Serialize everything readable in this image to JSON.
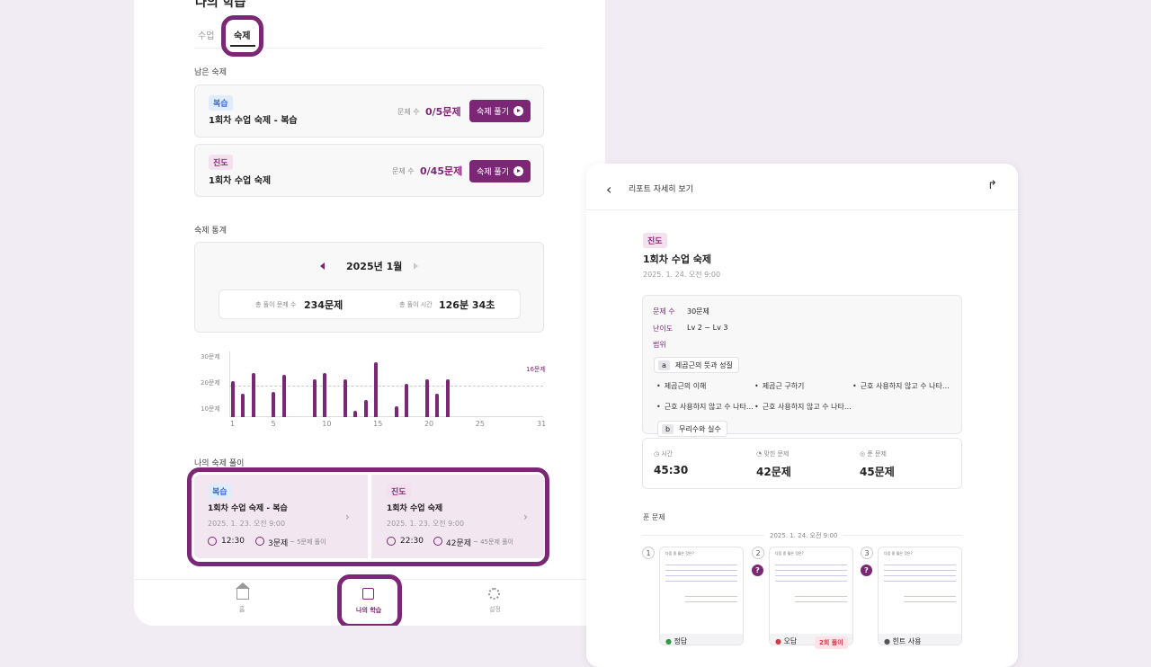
{
  "tabs": {
    "title": "나의 학습",
    "lesson": "수업",
    "homework": "숙제"
  },
  "remaining": {
    "heading": "남은 숙제",
    "items": [
      {
        "badge": "복습",
        "title": "1회차 수업 숙제 - 복습",
        "count_label": "문제 수",
        "count": "0/5문제",
        "button": "숙제 풀기"
      },
      {
        "badge": "진도",
        "title": "1회차 수업 숙제",
        "count_label": "문제 수",
        "count": "0/45문제",
        "button": "숙제 풀기"
      }
    ]
  },
  "stats": {
    "heading": "숙제 통계",
    "month": "2025년 1월",
    "total_label": "총 풀이 문제 수",
    "total": "234문제",
    "time_label": "총 풀이 시간",
    "time": "126분 34초"
  },
  "chart_data": {
    "type": "bar",
    "x": [
      1,
      2,
      3,
      5,
      6,
      9,
      10,
      12,
      13,
      14,
      15,
      17,
      18,
      20,
      21,
      22
    ],
    "values": [
      17,
      11,
      21,
      12,
      20,
      18,
      21,
      18,
      3,
      8,
      26,
      5,
      16,
      18,
      11,
      18
    ],
    "avg": {
      "value": 16,
      "label": "16문제"
    },
    "yticks": [
      "30문제",
      "20문제",
      "10문제"
    ],
    "ylim": [
      0,
      32
    ],
    "xticks": [
      "1",
      "5",
      "10",
      "15",
      "20",
      "25",
      "31"
    ],
    "xlim": [
      1,
      31
    ],
    "color": "#7b2775"
  },
  "solutions": {
    "heading": "나의 숙제 풀이",
    "items": [
      {
        "badge": "복습",
        "title": "1회차 수업 숙제 - 복습",
        "date": "2025. 1. 23. 오전 9:00",
        "time": "12:30",
        "count": "3문제",
        "sub": "~ 5문제 풀이"
      },
      {
        "badge": "진도",
        "title": "1회차 수업 숙제",
        "date": "2025. 1. 23. 오전 9:00",
        "time": "22:30",
        "count": "42문제",
        "sub": "~ 45문제 풀이"
      }
    ]
  },
  "nav": {
    "home": "홈",
    "study": "나의 학습",
    "settings": "설정"
  },
  "report": {
    "header": "리포트 자세히 보기",
    "badge": "진도",
    "title": "1회차 수업 숙제",
    "date": "2025. 1. 24. 오전 9:00",
    "count_label": "문제 수",
    "count": "30문제",
    "level_label": "난이도",
    "level": "Lv 2 ~ Lv 3",
    "range_label": "범위",
    "topic_a_tag": "a",
    "topic_a": "제곱근의 뜻과 성질",
    "bullets": [
      "제곱근의 이해",
      "제곱근 구하기",
      "근호 사용하지 않고 수 나타…",
      "근호 사용하지 않고 수 나타…",
      "근호 사용하지 않고 수 나타…"
    ],
    "topic_b_tag": "b",
    "topic_b": "무리수와 실수",
    "time_label": "시간",
    "time": "45:30",
    "correct_label": "맞힌 문제",
    "correct": "42문제",
    "solved_label": "푼 문제",
    "solved": "45문제",
    "solved_heading": "푼 문제",
    "solved_date": "2025. 1. 24. 오전 9:00",
    "questions": [
      {
        "num": "1",
        "status": "정답",
        "extra": ""
      },
      {
        "num": "2",
        "status": "오답",
        "extra": "2회 풀이"
      },
      {
        "num": "3",
        "status": "힌트 사용",
        "extra": ""
      }
    ],
    "thumb_title": "다음 중 옳은 것은?"
  }
}
